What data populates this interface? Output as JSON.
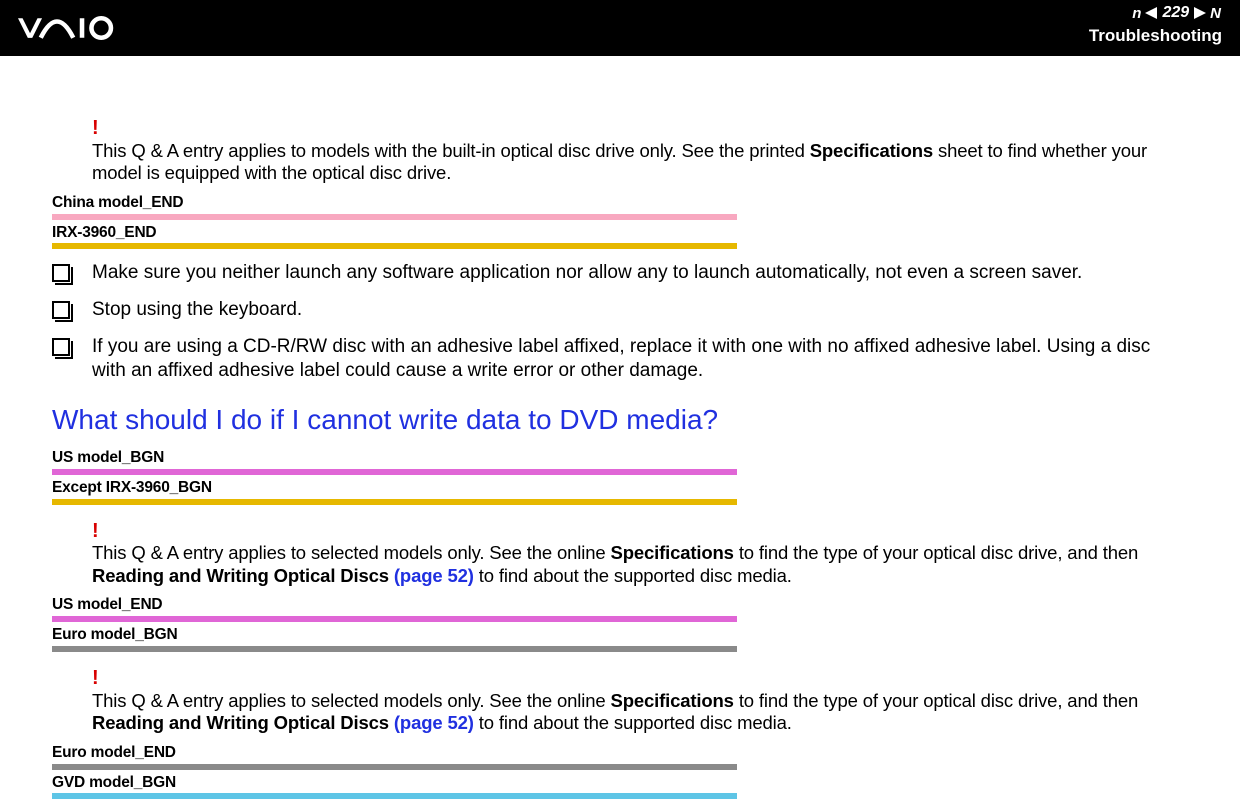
{
  "header": {
    "page_number": "229",
    "section": "Troubleshooting",
    "nav_n": "n",
    "nav_N": "N"
  },
  "note1": {
    "excl": "!",
    "t1": "This Q & A entry applies to models with the built-in optical disc drive only. See the printed ",
    "spec": "Specifications",
    "t2": " sheet to find whether your model is equipped with the optical disc drive."
  },
  "tags1": [
    {
      "label": "China model_END",
      "bar": "bar-pink"
    },
    {
      "label": "IRX-3960_END",
      "bar": "bar-yellow"
    }
  ],
  "bullets": [
    "Make sure you neither launch any software application nor allow any to launch automatically, not even a screen saver.",
    "Stop using the keyboard.",
    "If you are using a CD-R/RW disc with an adhesive label affixed, replace it with one with no affixed adhesive label. Using a disc with an affixed adhesive label could cause a write error or other damage."
  ],
  "question": "What should I do if I cannot write data to DVD media?",
  "tags2": [
    {
      "label": "US model_BGN",
      "bar": "bar-magenta"
    },
    {
      "label": "Except IRX-3960_BGN",
      "bar": "bar-yellow"
    }
  ],
  "note2": {
    "excl": "!",
    "t1": "This Q & A entry applies to selected models only. See the online ",
    "spec": "Specifications",
    "t2": " to find the type of your optical disc drive, and then ",
    "rw": "Reading and Writing Optical Discs ",
    "pg": "(page 52)",
    "t3": " to find about the supported disc media."
  },
  "tags3": [
    {
      "label": "US model_END",
      "bar": "bar-magenta"
    },
    {
      "label": "Euro model_BGN",
      "bar": "bar-gray"
    }
  ],
  "note3": {
    "excl": "!",
    "t1": "This Q & A entry applies to selected models only. See the online ",
    "spec": "Specifications",
    "t2": " to find the type of your optical disc drive, and then ",
    "rw": "Reading and Writing Optical Discs ",
    "pg": "(page 52)",
    "t3": " to find about the supported disc media."
  },
  "tags4": [
    {
      "label": "Euro model_END",
      "bar": "bar-gray"
    },
    {
      "label": "GVD model_BGN",
      "bar": "bar-cyan"
    }
  ]
}
